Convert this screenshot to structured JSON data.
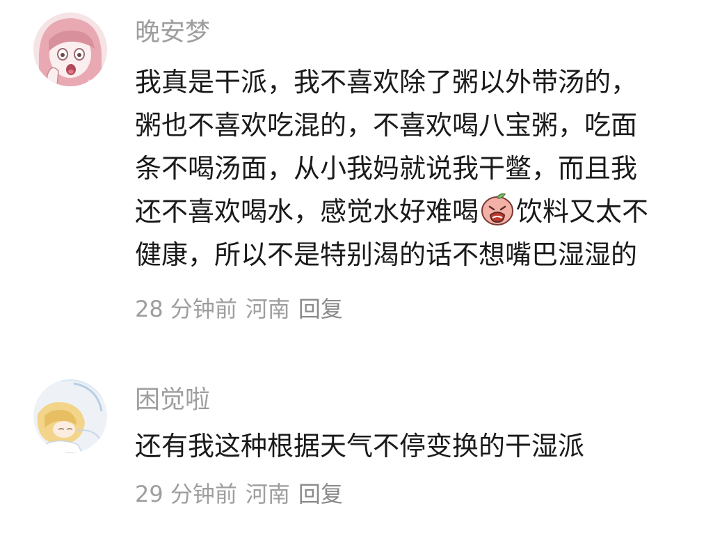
{
  "comments": [
    {
      "username": "晚安梦",
      "avatar_icon": "anime-girl-pink-avatar",
      "content_lines": [
        "我真是干派，我不喜欢除了粥以外带汤的，",
        "粥也不喜欢吃混的，不喜欢喝八宝粥，吃面",
        "条不喝汤面，从小我妈就说我干鳖，而且我",
        "还不喜欢喝水，感觉水好难喝",
        "饮料又太不",
        "健康，所以不是特别渴的话不想嘴巴湿湿的"
      ],
      "emoji_icon": "crying-peach-emoji",
      "time": "28 分钟前",
      "location": "河南",
      "reply_label": "回复"
    },
    {
      "username": "困觉啦",
      "avatar_icon": "anime-girl-blonde-avatar",
      "content_lines": [
        "还有我这种根据天气不停变换的干湿派"
      ],
      "time": "29 分钟前",
      "location": "河南",
      "reply_label": "回复"
    }
  ],
  "colors": {
    "text": "#1a1a1a",
    "secondary": "#9e9e9e",
    "background": "#ffffff"
  }
}
